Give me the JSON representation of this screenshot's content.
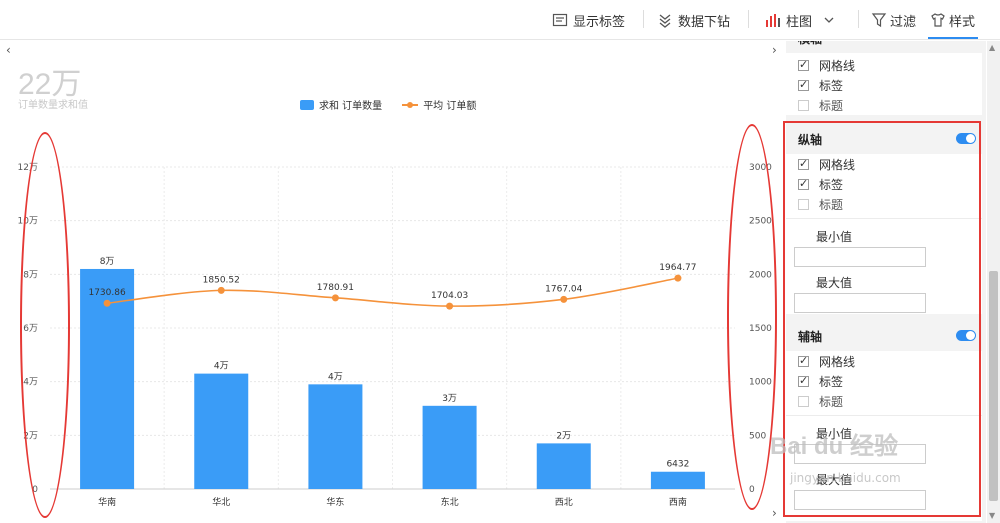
{
  "toolbar": {
    "show_labels": "显示标签",
    "drill_down": "数据下钻",
    "chart_type": "柱图",
    "filter": "过滤",
    "style": "样式"
  },
  "kpi": {
    "value": "22万",
    "label": "订单数量求和值"
  },
  "legend": {
    "bar_series": "求和 订单数量",
    "line_series": "平均 订单额"
  },
  "chart_data": {
    "type": "bar",
    "categories": [
      "华南",
      "华北",
      "华东",
      "东北",
      "西北",
      "西南"
    ],
    "series": [
      {
        "name": "求和 订单数量",
        "type": "bar",
        "axis": "left",
        "values": [
          82000,
          43000,
          39000,
          31000,
          17000,
          6432
        ],
        "data_labels": [
          "8万",
          "4万",
          "4万",
          "3万",
          "2万",
          "6432"
        ]
      },
      {
        "name": "平均 订单额",
        "type": "line",
        "axis": "right",
        "values": [
          1730.86,
          1850.52,
          1780.91,
          1704.03,
          1767.04,
          1964.77
        ],
        "data_labels": [
          "1730.86",
          "1850.52",
          "1780.91",
          "1704.03",
          "1767.04",
          "1964.77"
        ]
      }
    ],
    "y_left": {
      "ylim": [
        0,
        120000
      ],
      "tick_labels": [
        "0",
        "2万",
        "4万",
        "6万",
        "8万",
        "10万",
        "12万"
      ]
    },
    "y_right": {
      "ylim": [
        0,
        3000
      ],
      "tick_labels": [
        "0",
        "500",
        "1000",
        "1500",
        "2000",
        "2500",
        "3000"
      ]
    },
    "grid": true,
    "legend_position": "top-center",
    "colors": {
      "bar": "#3a9cf7",
      "line": "#f5923b"
    }
  },
  "settings": {
    "top_section": {
      "header": "横轴",
      "options": [
        {
          "label": "网格线",
          "checked": true
        },
        {
          "label": "标签",
          "checked": true
        },
        {
          "label": "标题",
          "checked": false
        }
      ]
    },
    "y_axis": {
      "header": "纵轴",
      "options": [
        {
          "label": "网格线",
          "checked": true
        },
        {
          "label": "标签",
          "checked": true
        },
        {
          "label": "标题",
          "checked": false
        }
      ],
      "min_label": "最小值",
      "max_label": "最大值",
      "min_value": "",
      "max_value": ""
    },
    "secondary_axis": {
      "header": "辅轴",
      "options": [
        {
          "label": "网格线",
          "checked": true
        },
        {
          "label": "标签",
          "checked": true
        },
        {
          "label": "标题",
          "checked": false
        }
      ],
      "min_label": "最小值",
      "max_label": "最大值",
      "min_value": "",
      "max_value": ""
    }
  },
  "watermark": {
    "main": "Bai du 经验",
    "sub": "jingyan.baidu.com"
  },
  "accent_color": "#2d8cf0",
  "annotation_color": "#e53935"
}
